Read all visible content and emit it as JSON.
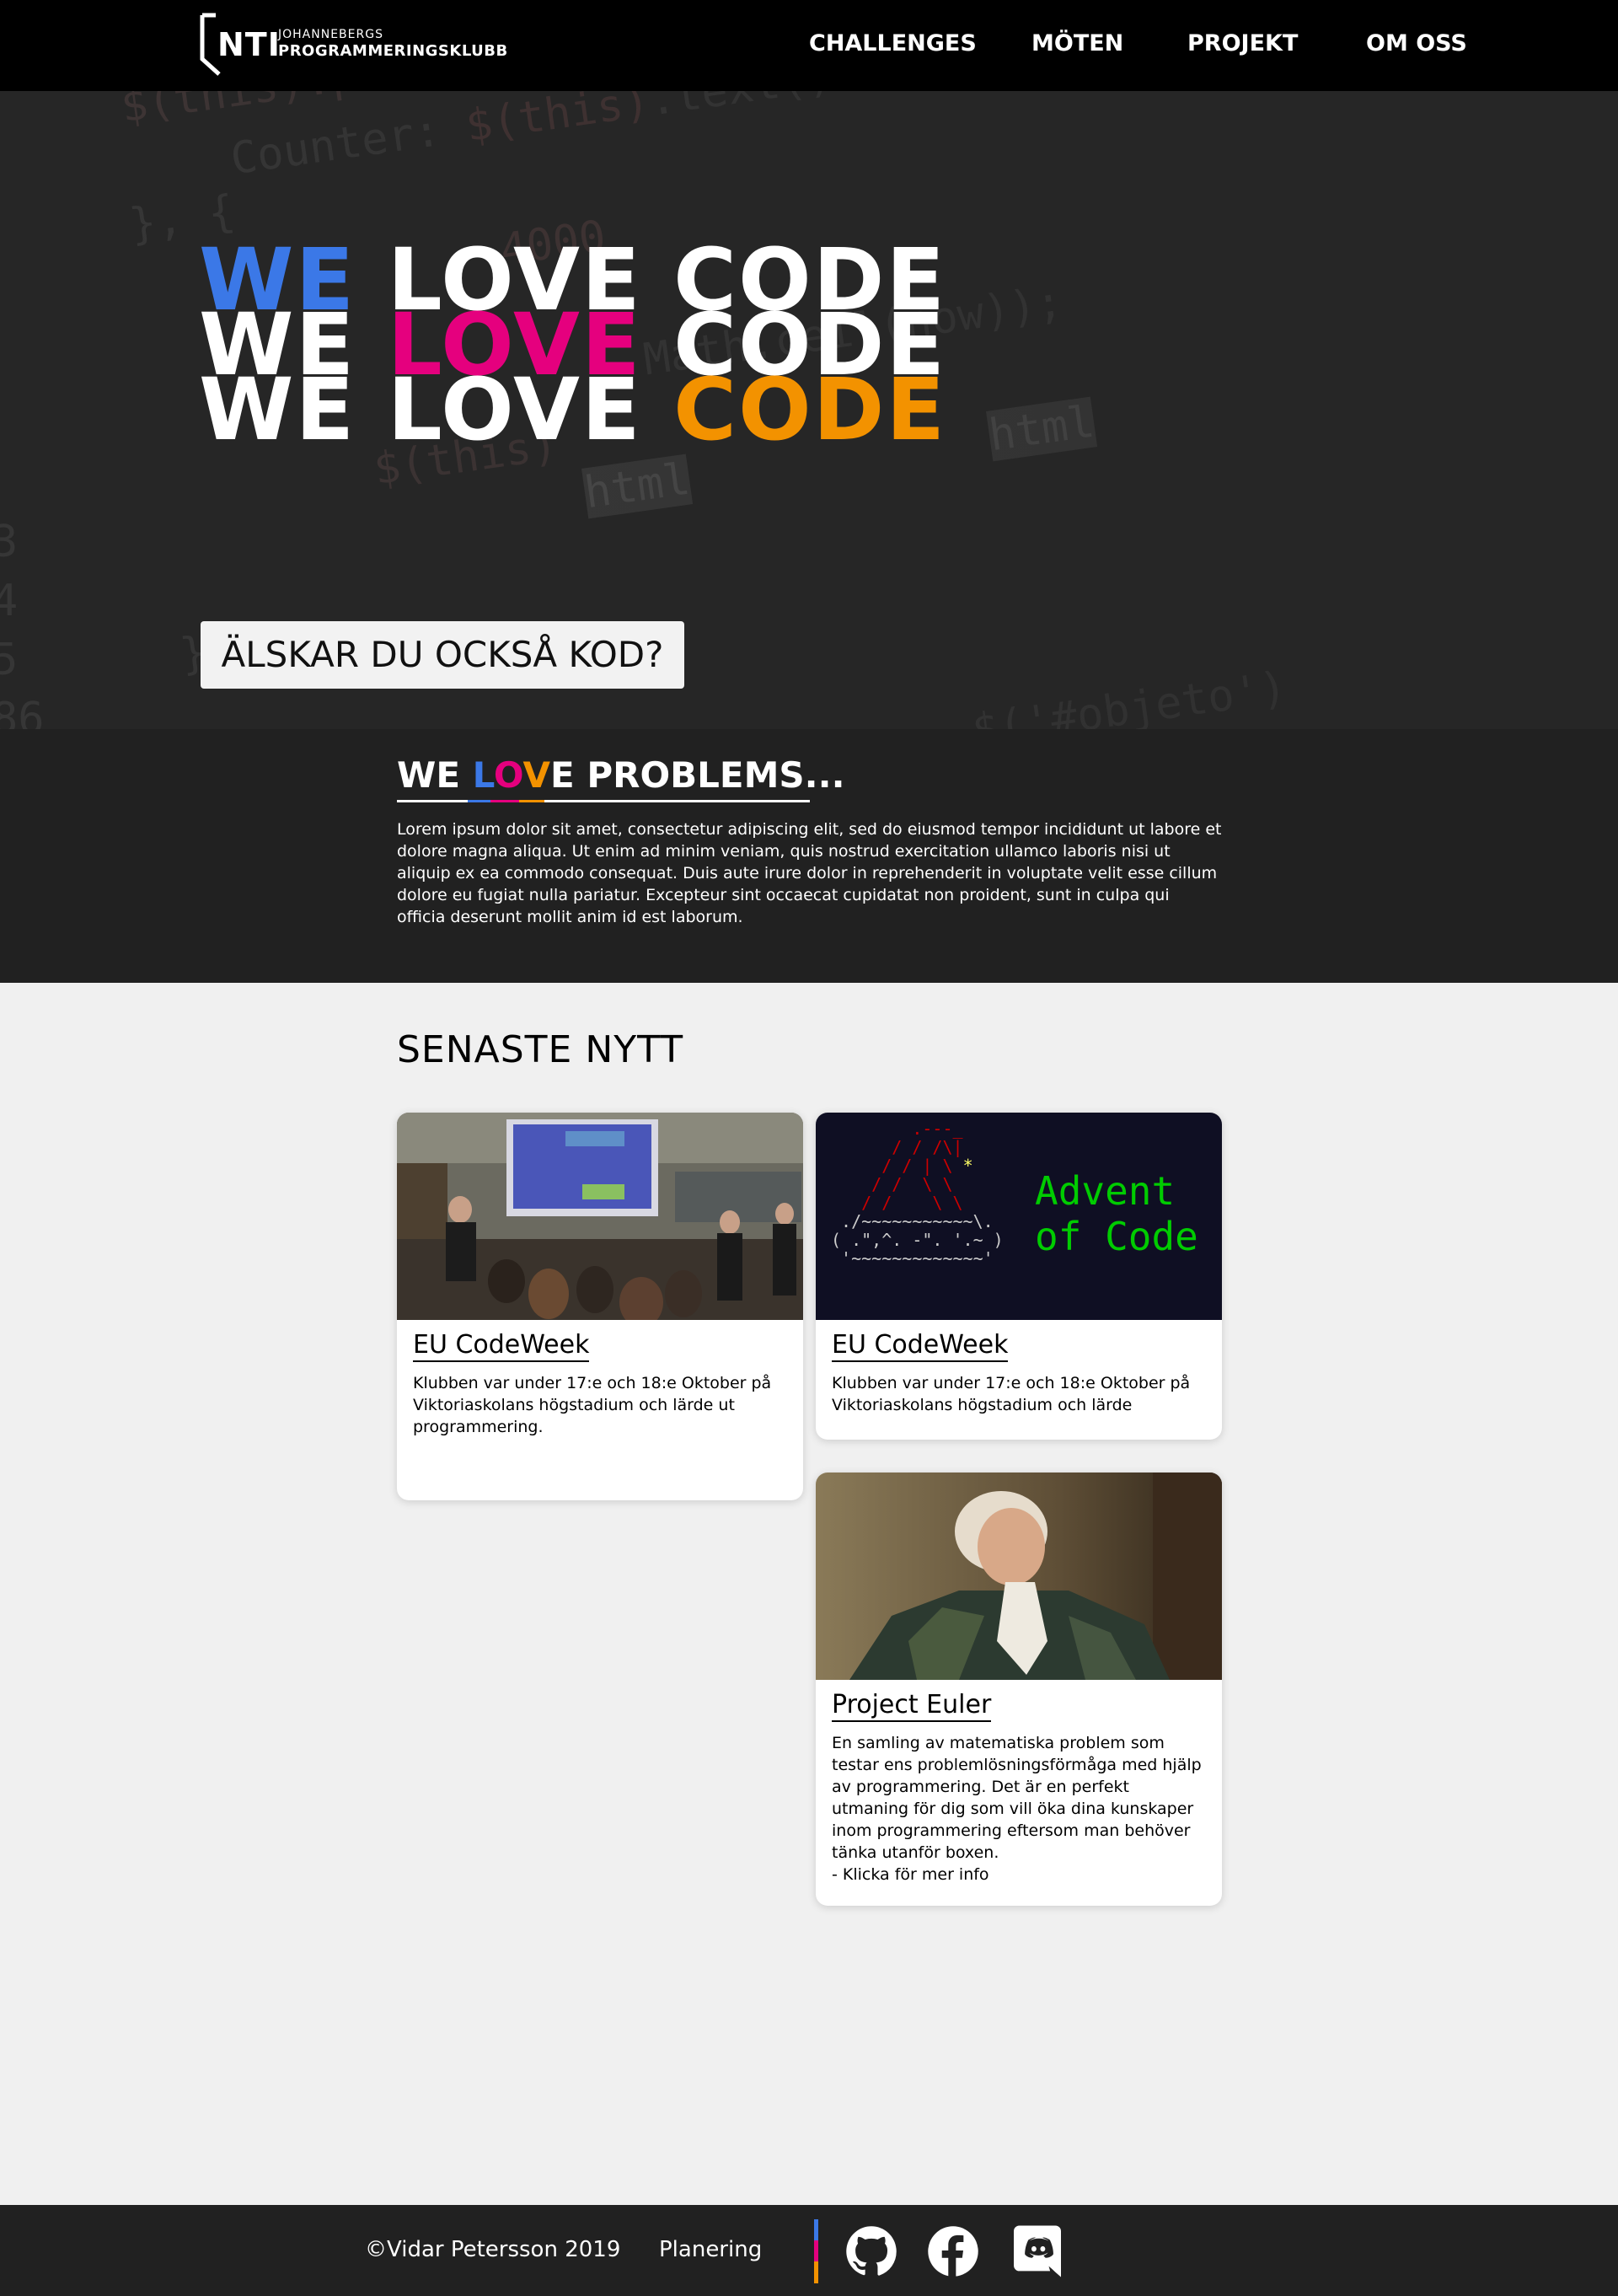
{
  "nav": {
    "logo": {
      "brand": "NTI",
      "line1": "JOHANNEBERGS",
      "line2": "PROGRAMMERINGSKLUBB"
    },
    "links": [
      "CHALLENGES",
      "MÖTEN",
      "PROJEKT",
      "OM OSS"
    ]
  },
  "hero": {
    "lines": [
      {
        "words": [
          "WE",
          "LOVE",
          "CODE"
        ],
        "highlight": 0
      },
      {
        "words": [
          "WE",
          "LOVE",
          "CODE"
        ],
        "highlight": 1
      },
      {
        "words": [
          "WE",
          "LOVE",
          "CODE"
        ],
        "highlight": 2
      }
    ],
    "highlight_colors": [
      "#3b78e7",
      "#e5007e",
      "#f39200"
    ],
    "cta_label": "ÄLSKAR DU OCKSÅ KOD?",
    "background_code": "$(this).prop('Counter', 0).text()\n   Counter: $(this).text()\n}, {\n   duration: 4000,\n   easing: 'swing',\n   step: function (now) {\n     $(this).text(Math.ceil(now));\n   }                    html\n   $(this).html\n});\n  });\n  $('#objeto')"
  },
  "intro": {
    "title_prefix": "WE ",
    "title_letters": [
      "L",
      "O",
      "V",
      "E"
    ],
    "title_suffix": " PROBLEMS...",
    "text": "Lorem ipsum dolor sit amet, consectetur adipiscing elit, sed do eiusmod tempor incididunt ut labore et dolore magna aliqua. Ut enim ad minim veniam, quis nostrud exercitation ullamco laboris nisi ut aliquip ex ea commodo consequat. Duis aute irure dolor in reprehenderit in voluptate velit esse cillum dolore eu fugiat nulla pariatur. Excepteur sint occaecat cupidatat non proident, sunt in culpa qui officia deserunt mollit anim id est laborum."
  },
  "news": {
    "title": "SENASTE NYTT",
    "cards": [
      {
        "title": "EU CodeWeek",
        "text": "Klubben var under 17:e och 18:e Oktober på Viktoriaskolans högstadium och lärde ut programmering.",
        "image": "classroom-presentation"
      },
      {
        "title": "EU CodeWeek",
        "text": "Klubben var under 17:e och 18:e Oktober på Viktoriaskolans högstadium och lärde",
        "image": "advent-of-code",
        "image_text": [
          "Advent",
          "of Code"
        ]
      },
      {
        "title": "Project Euler",
        "text": "En samling av matematiska problem som testar ens problemlösningsförmåga med hjälp av programmering. Det är en perfekt utmaning för dig som vill öka dina kunskaper inom programmering eftersom man behöver tänka utanför boxen.\n- Klicka för mer info",
        "image": "euler-portrait"
      }
    ]
  },
  "footer": {
    "copyright": "©Vidar Petersson 2019",
    "planning_link": "Planering",
    "icons": [
      "github-icon",
      "facebook-icon",
      "discord-icon"
    ]
  },
  "colors": {
    "blue": "#3b78e7",
    "pink": "#e5007e",
    "orange": "#f39200",
    "nav_bg": "#000000",
    "dark_bg": "#212121",
    "page_bg": "#f0f0f0"
  }
}
